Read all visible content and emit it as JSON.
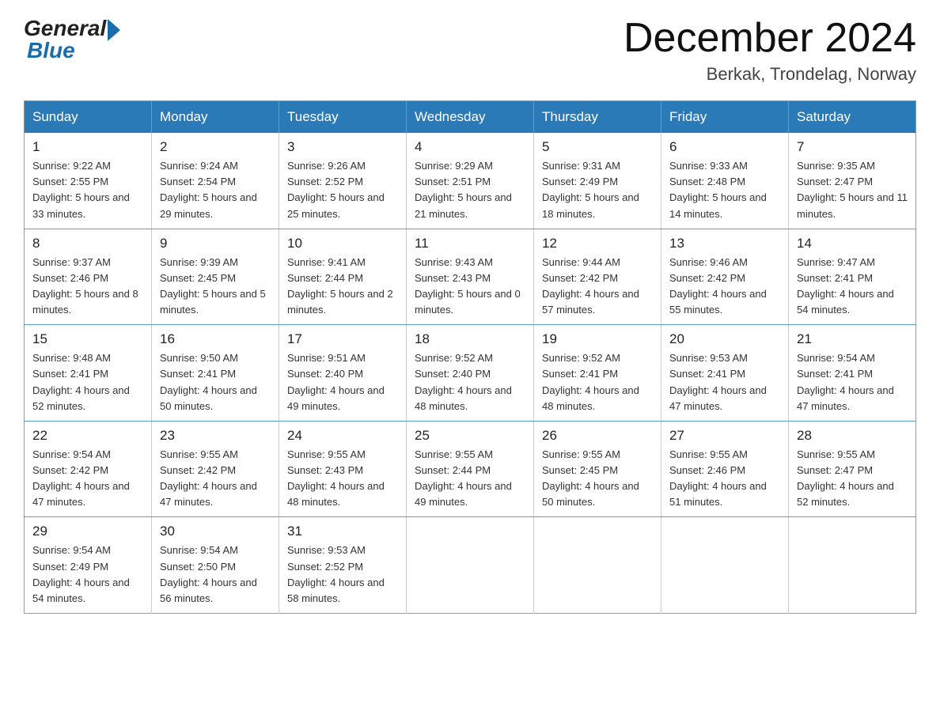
{
  "header": {
    "logo_general": "General",
    "logo_blue": "Blue",
    "month_title": "December 2024",
    "location": "Berkak, Trondelag, Norway"
  },
  "days_of_week": [
    "Sunday",
    "Monday",
    "Tuesday",
    "Wednesday",
    "Thursday",
    "Friday",
    "Saturday"
  ],
  "weeks": [
    [
      {
        "day": "1",
        "sunrise": "9:22 AM",
        "sunset": "2:55 PM",
        "daylight": "5 hours and 33 minutes."
      },
      {
        "day": "2",
        "sunrise": "9:24 AM",
        "sunset": "2:54 PM",
        "daylight": "5 hours and 29 minutes."
      },
      {
        "day": "3",
        "sunrise": "9:26 AM",
        "sunset": "2:52 PM",
        "daylight": "5 hours and 25 minutes."
      },
      {
        "day": "4",
        "sunrise": "9:29 AM",
        "sunset": "2:51 PM",
        "daylight": "5 hours and 21 minutes."
      },
      {
        "day": "5",
        "sunrise": "9:31 AM",
        "sunset": "2:49 PM",
        "daylight": "5 hours and 18 minutes."
      },
      {
        "day": "6",
        "sunrise": "9:33 AM",
        "sunset": "2:48 PM",
        "daylight": "5 hours and 14 minutes."
      },
      {
        "day": "7",
        "sunrise": "9:35 AM",
        "sunset": "2:47 PM",
        "daylight": "5 hours and 11 minutes."
      }
    ],
    [
      {
        "day": "8",
        "sunrise": "9:37 AM",
        "sunset": "2:46 PM",
        "daylight": "5 hours and 8 minutes."
      },
      {
        "day": "9",
        "sunrise": "9:39 AM",
        "sunset": "2:45 PM",
        "daylight": "5 hours and 5 minutes."
      },
      {
        "day": "10",
        "sunrise": "9:41 AM",
        "sunset": "2:44 PM",
        "daylight": "5 hours and 2 minutes."
      },
      {
        "day": "11",
        "sunrise": "9:43 AM",
        "sunset": "2:43 PM",
        "daylight": "5 hours and 0 minutes."
      },
      {
        "day": "12",
        "sunrise": "9:44 AM",
        "sunset": "2:42 PM",
        "daylight": "4 hours and 57 minutes."
      },
      {
        "day": "13",
        "sunrise": "9:46 AM",
        "sunset": "2:42 PM",
        "daylight": "4 hours and 55 minutes."
      },
      {
        "day": "14",
        "sunrise": "9:47 AM",
        "sunset": "2:41 PM",
        "daylight": "4 hours and 54 minutes."
      }
    ],
    [
      {
        "day": "15",
        "sunrise": "9:48 AM",
        "sunset": "2:41 PM",
        "daylight": "4 hours and 52 minutes."
      },
      {
        "day": "16",
        "sunrise": "9:50 AM",
        "sunset": "2:41 PM",
        "daylight": "4 hours and 50 minutes."
      },
      {
        "day": "17",
        "sunrise": "9:51 AM",
        "sunset": "2:40 PM",
        "daylight": "4 hours and 49 minutes."
      },
      {
        "day": "18",
        "sunrise": "9:52 AM",
        "sunset": "2:40 PM",
        "daylight": "4 hours and 48 minutes."
      },
      {
        "day": "19",
        "sunrise": "9:52 AM",
        "sunset": "2:41 PM",
        "daylight": "4 hours and 48 minutes."
      },
      {
        "day": "20",
        "sunrise": "9:53 AM",
        "sunset": "2:41 PM",
        "daylight": "4 hours and 47 minutes."
      },
      {
        "day": "21",
        "sunrise": "9:54 AM",
        "sunset": "2:41 PM",
        "daylight": "4 hours and 47 minutes."
      }
    ],
    [
      {
        "day": "22",
        "sunrise": "9:54 AM",
        "sunset": "2:42 PM",
        "daylight": "4 hours and 47 minutes."
      },
      {
        "day": "23",
        "sunrise": "9:55 AM",
        "sunset": "2:42 PM",
        "daylight": "4 hours and 47 minutes."
      },
      {
        "day": "24",
        "sunrise": "9:55 AM",
        "sunset": "2:43 PM",
        "daylight": "4 hours and 48 minutes."
      },
      {
        "day": "25",
        "sunrise": "9:55 AM",
        "sunset": "2:44 PM",
        "daylight": "4 hours and 49 minutes."
      },
      {
        "day": "26",
        "sunrise": "9:55 AM",
        "sunset": "2:45 PM",
        "daylight": "4 hours and 50 minutes."
      },
      {
        "day": "27",
        "sunrise": "9:55 AM",
        "sunset": "2:46 PM",
        "daylight": "4 hours and 51 minutes."
      },
      {
        "day": "28",
        "sunrise": "9:55 AM",
        "sunset": "2:47 PM",
        "daylight": "4 hours and 52 minutes."
      }
    ],
    [
      {
        "day": "29",
        "sunrise": "9:54 AM",
        "sunset": "2:49 PM",
        "daylight": "4 hours and 54 minutes."
      },
      {
        "day": "30",
        "sunrise": "9:54 AM",
        "sunset": "2:50 PM",
        "daylight": "4 hours and 56 minutes."
      },
      {
        "day": "31",
        "sunrise": "9:53 AM",
        "sunset": "2:52 PM",
        "daylight": "4 hours and 58 minutes."
      },
      null,
      null,
      null,
      null
    ]
  ]
}
